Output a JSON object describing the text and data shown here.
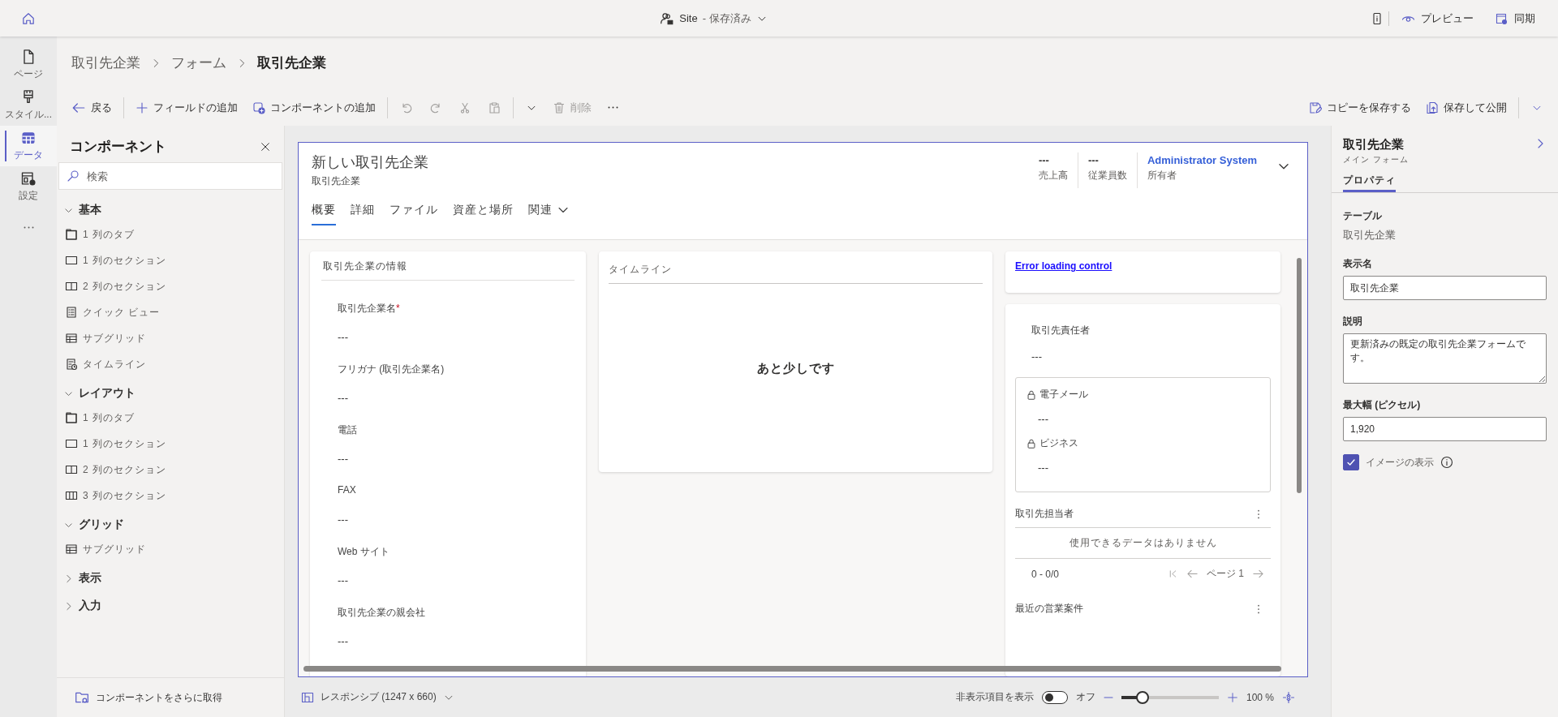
{
  "top_bar": {
    "site_name": "Site",
    "save_status": "- 保存済み",
    "actions": [
      "プレビュー",
      "同期"
    ]
  },
  "rail": [
    {
      "label": "ページ",
      "selected": false
    },
    {
      "label": "スタイル...",
      "selected": false
    },
    {
      "label": "データ",
      "selected": true
    },
    {
      "label": "設定",
      "selected": false
    }
  ],
  "breadcrumb": [
    "取引先企業",
    "フォーム",
    "取引先企業"
  ],
  "toolbar": {
    "items": [
      {
        "label": "戻る",
        "disabled": false
      },
      {
        "label": "フィールドの追加",
        "disabled": false
      },
      {
        "label": "コンポーネントの追加",
        "disabled": false
      },
      {
        "label": "削除",
        "disabled": true
      }
    ],
    "right": [
      "コピーを保存する",
      "保存して公開"
    ]
  },
  "components_panel": {
    "title": "コンポーネント",
    "search": {
      "placeholder": "検索"
    },
    "groups": [
      {
        "title": "基本",
        "expanded": true,
        "items": [
          {
            "label": "1 列のタブ",
            "kind": "tab"
          },
          {
            "label": "1 列のセクション",
            "kind": "section1"
          },
          {
            "label": "2 列のセクション",
            "kind": "section2"
          },
          {
            "label": "クイック ビュー",
            "kind": "quickview"
          },
          {
            "label": "サブグリッド",
            "kind": "subgrid"
          },
          {
            "label": "タイムライン",
            "kind": "timeline"
          }
        ]
      },
      {
        "title": "レイアウト",
        "expanded": true,
        "items": [
          {
            "label": "1 列のタブ",
            "kind": "tab"
          },
          {
            "label": "1 列のセクション",
            "kind": "section1"
          },
          {
            "label": "2 列のセクション",
            "kind": "section2"
          },
          {
            "label": "3 列のセクション",
            "kind": "section3"
          }
        ]
      },
      {
        "title": "グリッド",
        "expanded": true,
        "items": [
          {
            "label": "サブグリッド",
            "kind": "subgrid"
          }
        ]
      },
      {
        "title": "表示",
        "expanded": false
      },
      {
        "title": "入力",
        "expanded": false
      }
    ],
    "footer": "コンポーネントをさらに取得"
  },
  "form": {
    "title": "新しい取引先企業",
    "subtitle": "取引先企業",
    "header_fields": [
      {
        "value": "---",
        "label": "売上高"
      },
      {
        "value": "---",
        "label": "従業員数"
      }
    ],
    "owner": {
      "value": "Administrator System",
      "label": "所有者"
    },
    "tabs": [
      {
        "label": "概要",
        "selected": true,
        "menu": false
      },
      {
        "label": "詳細",
        "selected": false,
        "menu": false
      },
      {
        "label": "ファイル",
        "selected": false,
        "menu": false
      },
      {
        "label": "資産と場所",
        "selected": false,
        "menu": false
      },
      {
        "label": "関連",
        "selected": false,
        "menu": true
      }
    ],
    "info_section": {
      "title": "取引先企業の情報",
      "fields": [
        {
          "label": "取引先企業名",
          "required_mark": "*",
          "value": "---"
        },
        {
          "label": "フリガナ (取引先企業名)",
          "value": "---"
        },
        {
          "label": "電話",
          "value": "---"
        },
        {
          "label": "FAX",
          "value": "---"
        },
        {
          "label": "Web サイト",
          "value": "---"
        },
        {
          "label": "取引先企業の親会社",
          "value": "---"
        }
      ]
    },
    "timeline": {
      "title": "タイムライン",
      "message": "あと少しです"
    },
    "error_link": "Error loading control",
    "contact_section": {
      "field": {
        "label": "取引先責任者",
        "value": "---"
      },
      "locked_fields": [
        {
          "label": "電子メール",
          "locked": true,
          "value": "---"
        },
        {
          "label": "ビジネス",
          "locked": true,
          "value": "---"
        }
      ],
      "subgrid": {
        "title": "取引先担当者",
        "empty": "使用できるデータはありません",
        "count": "0 - 0/0",
        "page": "ページ 1"
      },
      "subgrid2": {
        "title": "最近の営業案件"
      }
    }
  },
  "canvas_bar": {
    "layout": "レスポンシブ (1247 x 660)",
    "hidden_label": "非表示項目を表示",
    "hidden_toggle": {
      "on": false,
      "state_label": "オフ"
    },
    "zoom": {
      "level": 0.22,
      "reading": "100 %"
    }
  },
  "properties": {
    "title": "取引先企業",
    "subtitle": "メイン フォーム",
    "tabs": [
      {
        "label": "プロパティ",
        "selected": true
      }
    ],
    "table_label": "テーブル",
    "table_value": "取引先企業",
    "display_name": {
      "label": "表示名",
      "value": "取引先企業"
    },
    "description": {
      "label": "説明",
      "value": "更新済みの既定の取引先企業フォームです。"
    },
    "max_width": {
      "label": "最大幅 (ピクセル)",
      "value": "1,920"
    },
    "show_image": {
      "label": "イメージの表示",
      "checked": true
    }
  }
}
